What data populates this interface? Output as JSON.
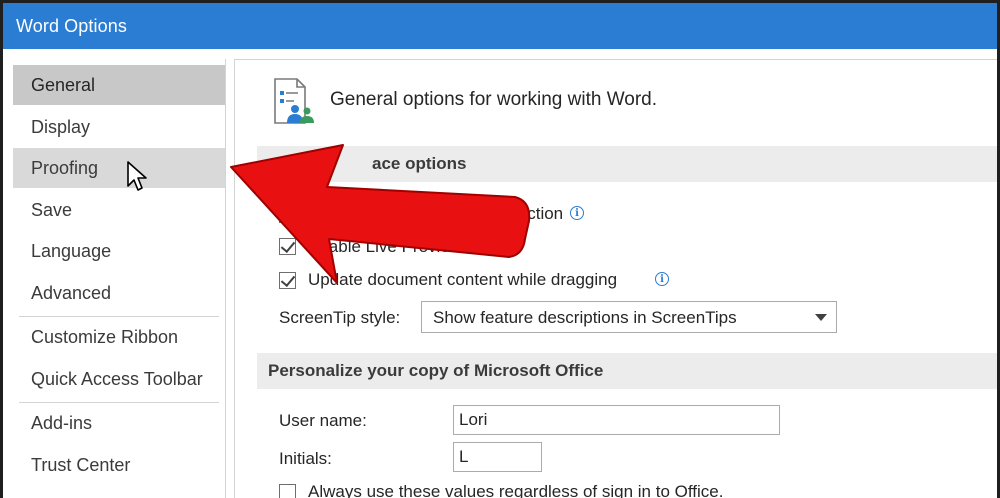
{
  "window": {
    "title": "Word Options"
  },
  "sidebar": {
    "items": [
      {
        "label": "General"
      },
      {
        "label": "Display"
      },
      {
        "label": "Proofing"
      },
      {
        "label": "Save"
      },
      {
        "label": "Language"
      },
      {
        "label": "Advanced"
      },
      {
        "label": "Customize Ribbon"
      },
      {
        "label": "Quick Access Toolbar"
      },
      {
        "label": "Add-ins"
      },
      {
        "label": "Trust Center"
      }
    ],
    "selected": "General",
    "hovered": "Proofing"
  },
  "main": {
    "header": "General options for working with Word.",
    "header_icon": "options-people-icon",
    "sections": {
      "ui_options": {
        "title_visible": "ace options",
        "options": [
          {
            "label_visible": "lection",
            "checked": true,
            "info_icon": true
          },
          {
            "label": "Enable Live Preview",
            "checked": true,
            "info_icon": true
          },
          {
            "label": "Update document content while dragging",
            "checked": true,
            "info_icon": true
          }
        ],
        "screentip": {
          "label": "ScreenTip style:",
          "value": "Show feature descriptions in ScreenTips"
        }
      },
      "personalize": {
        "title": "Personalize your copy of Microsoft Office",
        "username_label": "User name:",
        "username_value": "Lori",
        "initials_label": "Initials:",
        "initials_value": "L",
        "always_use_label": "Always use these values regardless of sign in to Office.",
        "always_use_checked": false
      }
    }
  },
  "annotation": {
    "type": "red-arrow-pointing-left",
    "color": "#e81010"
  },
  "colors": {
    "titlebar": "#2b7cd3",
    "selected": "#c8c8c8",
    "hover": "#d9d9d9",
    "section": "#ececec"
  }
}
